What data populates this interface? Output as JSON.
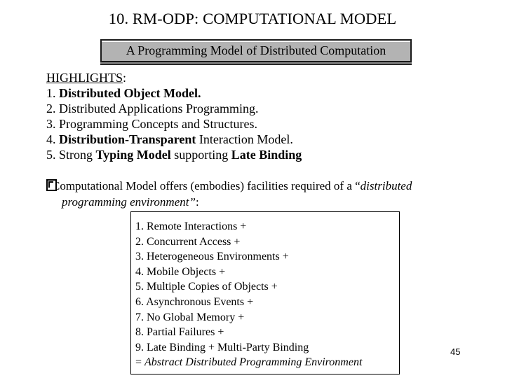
{
  "slide": {
    "title": "10. RM-ODP: COMPUTATIONAL MODEL",
    "subtitle": "A Programming Model of Distributed Computation",
    "page_number": "45"
  },
  "highlights": {
    "heading": "HIGHLIGHTS",
    "heading_suffix": ":",
    "items": [
      {
        "num": "1. ",
        "parts": [
          {
            "text": "Distributed Object Model.",
            "bold": true
          }
        ]
      },
      {
        "num": "2. ",
        "parts": [
          {
            "text": "Distributed Applications Programming.",
            "bold": false
          }
        ]
      },
      {
        "num": "3. ",
        "parts": [
          {
            "text": "Programming Concepts and Structures.",
            "bold": false
          }
        ]
      },
      {
        "num": "4. ",
        "parts": [
          {
            "text": "Distribution-Transparent",
            "bold": true
          },
          {
            "text": " Interaction Model.",
            "bold": false
          }
        ]
      },
      {
        "num": "5. ",
        "parts": [
          {
            "text": "Strong ",
            "bold": false
          },
          {
            "text": "Typing Model",
            "bold": true
          },
          {
            "text": " supporting ",
            "bold": false
          },
          {
            "text": "Late Binding",
            "bold": true
          }
        ]
      }
    ]
  },
  "paragraph": {
    "bullet_icon": "missing-glyph-box",
    "line1_text": "Computational Model offers (embodies) facilities required of a “",
    "line1_italic": "distributed",
    "line2_italic": "programming environment”",
    "line2_suffix": ":"
  },
  "requirements": {
    "items": [
      "1. Remote Interactions +",
      "2. Concurrent Access +",
      "3. Heterogeneous Environments +",
      "4. Mobile Objects +",
      "5. Multiple Copies of Objects +",
      "6. Asynchronous Events +",
      "7. No Global Memory +",
      "8. Partial Failures +",
      "9. Late Binding + Multi-Party Binding"
    ],
    "summary_prefix": "= ",
    "summary": "Abstract Distributed Programming Environment"
  }
}
